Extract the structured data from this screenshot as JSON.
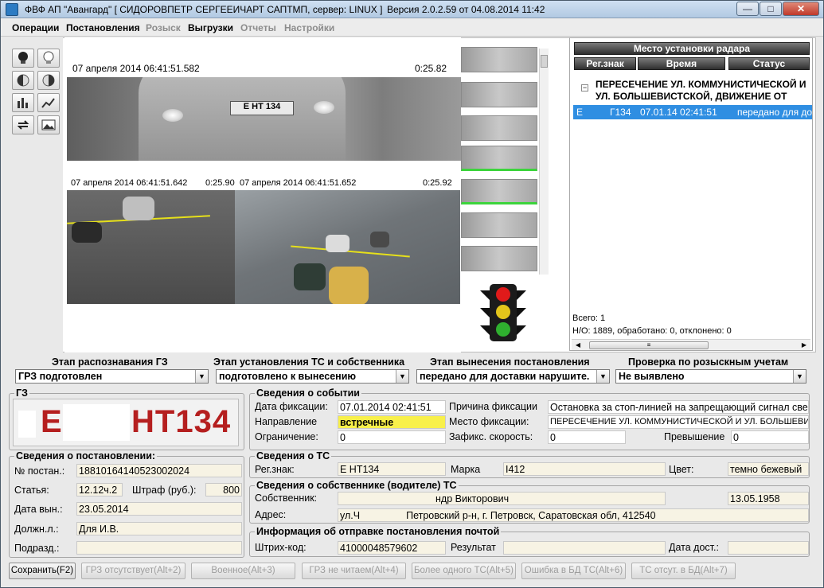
{
  "window": {
    "title": "ФВФ АП \"Авангард\" [ СИДОРОВПЕТР СЕРГЕЕИЧАРТ САПТМП, сервер: LINUX ]",
    "version": "Версия 2.0.2.59 от 04.08.2014 11:42",
    "minimize": "—",
    "maximize": "□",
    "close": "✕"
  },
  "menu": [
    {
      "label": "Операции",
      "enabled": true
    },
    {
      "label": "Постановления",
      "enabled": true
    },
    {
      "label": "Розыск",
      "enabled": false
    },
    {
      "label": "Выгрузки",
      "enabled": true
    },
    {
      "label": "Отчеты",
      "enabled": false
    },
    {
      "label": "Настройки",
      "enabled": false
    }
  ],
  "toolbar_icons": [
    "bulb-on-icon",
    "bulb-off-icon",
    "contrast-left-icon",
    "contrast-right-icon",
    "histogram-icon",
    "chart-icon",
    "refresh-icon",
    "image-icon"
  ],
  "photos": {
    "main_timestamp": "07 апреля 2014 06:41:51.582",
    "main_duration": "0:25.82",
    "small1_timestamp": "07 апреля 2014 06:41:51.642",
    "small1_duration": "0:25.90",
    "small2_timestamp": "07 апреля 2014 06:41:51.652",
    "small2_duration": "0:25.92",
    "plate_in_photo": "Е    НТ 134"
  },
  "radar_panel": {
    "header": "Место установки радара",
    "col_plate": "Рег.знак",
    "col_time": "Время",
    "col_status": "Статус",
    "tree_minus": "−",
    "location": "ПЕРЕСЕЧЕНИЕ УЛ. КОММУНИСТИЧЕСКОЙ И УЛ. БОЛЬШЕВИСТСКОЙ, ДВИЖЕНИЕ ОТ",
    "row": {
      "plate_start": "Е",
      "plate": "Г134",
      "time": "07.01.14 02:41:51",
      "status": "передано для до"
    },
    "total": "Всего: 1",
    "stats": "Н/О: 1889, обработано: 0, отклонено: 0"
  },
  "stages": [
    {
      "label": "Этап распознавания ГЗ",
      "value": "ГРЗ подготовлен"
    },
    {
      "label": "Этап установления ТС и собственника",
      "value": "подготовлено к вынесению"
    },
    {
      "label": "Этап вынесения постановления",
      "value": "передано для доставки нарушите."
    },
    {
      "label": "Проверка по розыскным учетам",
      "value": "Не выявлено"
    }
  ],
  "gz": {
    "title": "ГЗ",
    "plate_start": "Е",
    "plate_end": "НТ134"
  },
  "event": {
    "title": "Сведения о событии",
    "date_label": "Дата фиксации:",
    "date": "07.01.2014 02:41:51",
    "reason_label": "Причина фиксации",
    "reason": "Остановка за стоп-линией на запрещающий сигнал све",
    "direction_label": "Направление",
    "direction": "встречные",
    "place_label": "Место фиксации:",
    "place": "ПЕРЕСЕЧЕНИЕ УЛ. КОММУНИСТИЧЕСКОЙ И УЛ. БОЛЬШЕВИСТСК",
    "limit_label": "Ограничение:",
    "limit": "0",
    "speed_label": "Зафикс. скорость:",
    "speed": "0",
    "excess_label": "Превышение",
    "excess": "0"
  },
  "decree": {
    "title": "Сведения о постановлении:",
    "number_label": "№ постан.:",
    "number": "18810164140523002024",
    "article_label": "Статья:",
    "article": "12.12ч.2",
    "fine_label": "Штраф (руб.):",
    "fine": "800",
    "date_label": "Дата вын.:",
    "date": "23.05.2014",
    "official_label": "Должн.л.:",
    "official": "Для И.В.",
    "division_label": "Подразд.:",
    "division": ""
  },
  "vehicle": {
    "title": "Сведения о ТС",
    "plate_label": "Рег.знак:",
    "plate": "Е      НТ134",
    "brand_label": "Марка",
    "brand": "I412",
    "color_label": "Цвет:",
    "color": "темно бежевый"
  },
  "owner": {
    "title": "Сведения о собственнике (водителе) ТС",
    "owner_label": "Собственник:",
    "owner": "ндр Викторович",
    "birth": "13.05.1958",
    "address_label": "Адрес:",
    "address_start": "ул.Ч",
    "address": "Петровский р-н, г. Петровск, Саратовская обл, 412540"
  },
  "mail": {
    "title": "Информация об отправке постановления почтой",
    "barcode_label": "Штрих-код:",
    "barcode": "41000048579602",
    "result_label": "Результат",
    "result": "",
    "delivery_label": "Дата дост.:",
    "delivery": ""
  },
  "buttons": [
    {
      "label": "Сохранить(F2)",
      "enabled": true
    },
    {
      "label": "ГРЗ отсутствует(Alt+2)",
      "enabled": false
    },
    {
      "label": "Военное(Alt+3)",
      "enabled": false
    },
    {
      "label": "ГРЗ не читаем(Alt+4)",
      "enabled": false
    },
    {
      "label": "Более одного ТС(Alt+5)",
      "enabled": false
    },
    {
      "label": "Ошибка в БД ТС(Alt+6)",
      "enabled": false
    },
    {
      "label": "ТС отсут. в БД(Alt+7)",
      "enabled": false
    }
  ],
  "colors": {
    "plate_red": "#b51f1f",
    "selection_blue": "#2f8ee2",
    "highlight_yellow": "#f8f04a",
    "field_cream": "#f7f3e4"
  }
}
